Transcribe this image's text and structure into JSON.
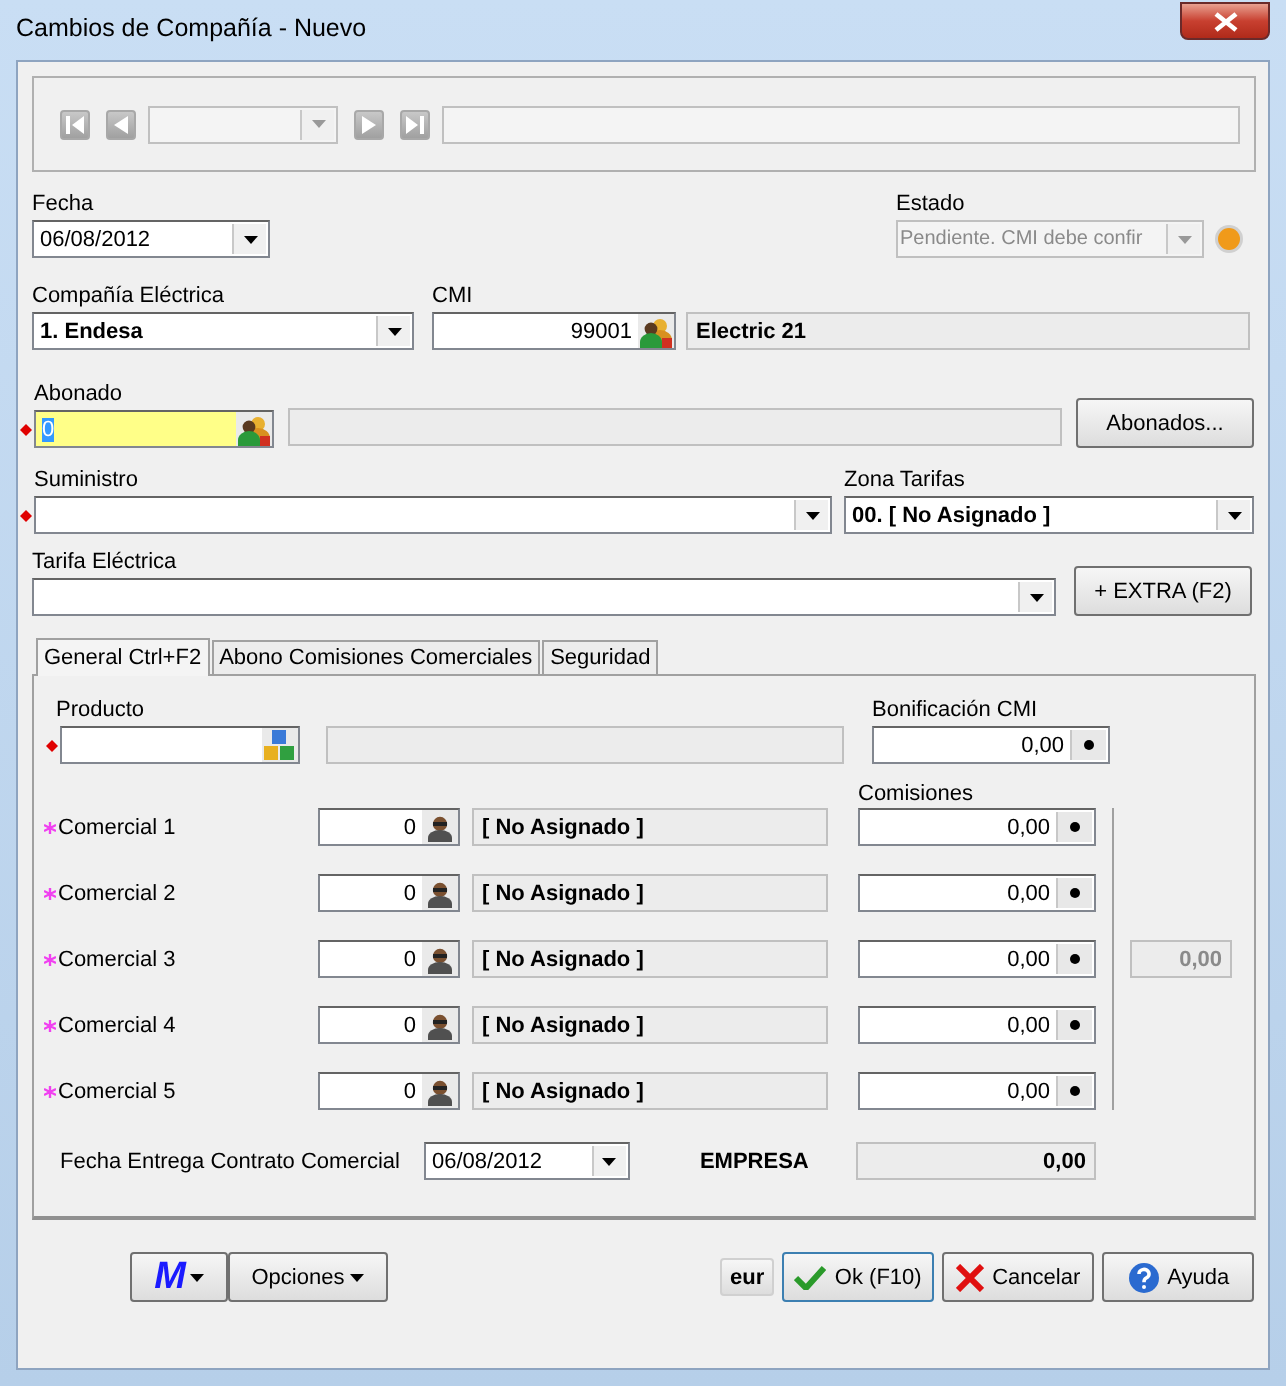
{
  "window": {
    "title": "Cambios de Compañía - Nuevo"
  },
  "fecha": {
    "label": "Fecha",
    "value": "06/08/2012"
  },
  "estado": {
    "label": "Estado",
    "value": "Pendiente. CMI debe confir",
    "disabled": true
  },
  "compania": {
    "label": "Compañía Eléctrica",
    "value": "1. Endesa"
  },
  "cmi": {
    "label": "CMI",
    "code": "99001",
    "name": "Electric 21"
  },
  "abonado": {
    "label": "Abonado",
    "value": "0",
    "focused": true,
    "required": true,
    "button": "Abonados..."
  },
  "suministro": {
    "label": "Suministro",
    "required": true
  },
  "zona_tarifas": {
    "label": "Zona Tarifas",
    "value": "00. [ No Asignado ]"
  },
  "tarifa": {
    "label": "Tarifa Eléctrica",
    "button": "+ EXTRA (F2)"
  },
  "tabs": [
    {
      "label": "General Ctrl+F2",
      "selected": true
    },
    {
      "label": "Abono Comisiones Comerciales",
      "selected": false
    },
    {
      "label": "Seguridad",
      "selected": false
    }
  ],
  "producto": {
    "label": "Producto",
    "required": true
  },
  "bonificacion": {
    "label": "Bonificación CMI",
    "value": "0,00"
  },
  "comisiones": {
    "label": "Comisiones",
    "total": "0,00",
    "rows": [
      {
        "label": "Comercial 1",
        "required": true,
        "code": "0",
        "name": "[ No Asignado ]",
        "value": "0,00"
      },
      {
        "label": "Comercial 2",
        "required": true,
        "code": "0",
        "name": "[ No Asignado ]",
        "value": "0,00"
      },
      {
        "label": "Comercial 3",
        "required": true,
        "code": "0",
        "name": "[ No Asignado ]",
        "value": "0,00"
      },
      {
        "label": "Comercial 4",
        "required": true,
        "code": "0",
        "name": "[ No Asignado ]",
        "value": "0,00"
      },
      {
        "label": "Comercial 5",
        "required": true,
        "code": "0",
        "name": "[ No Asignado ]",
        "value": "0,00"
      }
    ]
  },
  "fecha_entrega": {
    "label": "Fecha Entrega Contrato Comercial",
    "value": "06/08/2012"
  },
  "empresa": {
    "label": "EMPRESA",
    "value": "0,00"
  },
  "footer": {
    "menu": "M",
    "options": "Opciones",
    "currency": "eur",
    "ok": "Ok (F10)",
    "cancel": "Cancelar",
    "help": "Ayuda"
  }
}
